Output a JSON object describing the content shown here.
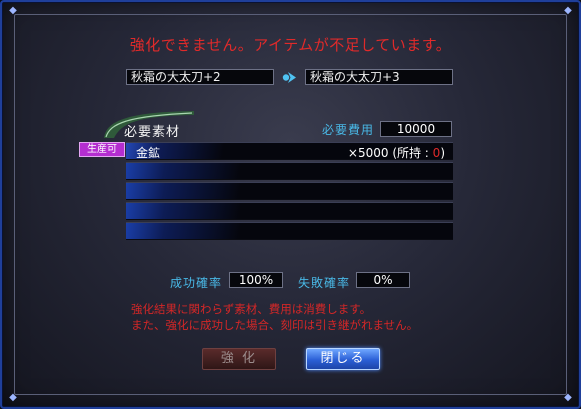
{
  "dialog": {
    "error_message": "強化できません。アイテムが不足しています。",
    "source_item": "秋霜の大太刀+2",
    "target_item": "秋霜の大太刀+3",
    "materials_title": "必要素材",
    "cost_label": "必要費用",
    "cost_value": "10000",
    "producible_badge": "生産可",
    "materials": [
      {
        "name": "金鉱",
        "qty_prefix": "×5000 (所持 : ",
        "held": "0",
        "qty_suffix": ")"
      }
    ],
    "empty_material_rows": 4,
    "success_label": "成功確率",
    "success_value": "100%",
    "failure_label": "失敗確率",
    "failure_value": "0%",
    "warning_line1": "強化結果に関わらず素材、費用は消費します。",
    "warning_line2": "また、強化に成功した場合、刻印は引き継がれません。",
    "enhance_button": "強 化",
    "close_button": "閉じる"
  },
  "colors": {
    "error_text": "#e02a2a",
    "label_blue": "#49b8e6",
    "badge_purple": "#b42ed0",
    "frame_blue": "#1f3f9a"
  },
  "icons": {
    "arrow": "right-arrow-icon",
    "emblem": "leaf-emblem-icon"
  }
}
